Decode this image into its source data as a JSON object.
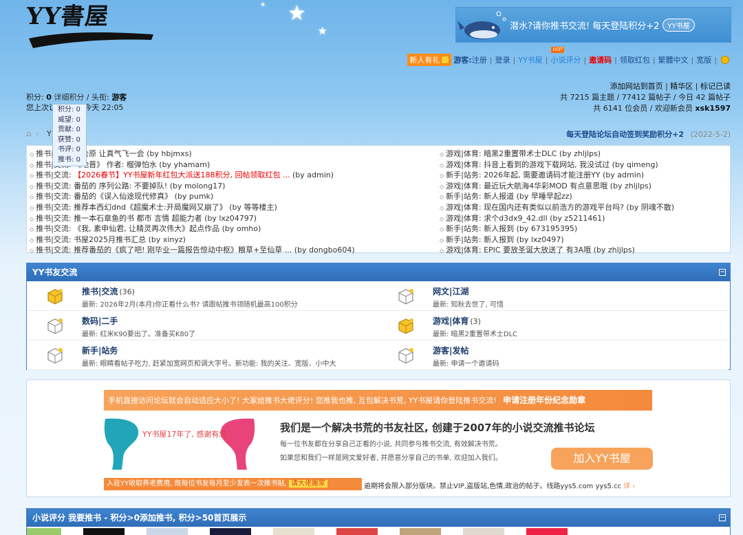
{
  "header": {
    "logo_text": "YY書屋",
    "banner_text": "潜水?请你推书交流! 每天登陆积分+2",
    "banner_badge": "YY书屋"
  },
  "topnav": {
    "newbie": "新人有礼",
    "guest_label": "游客:",
    "register": "注册",
    "login": "登录",
    "yy_shuwu": "YY书屋",
    "hot_badge": "HOT",
    "novel_rating": "小说评分",
    "invite_code": "邀请码",
    "red_packet": "领取红包",
    "trad_simp": "繁體中文",
    "wide": "宽版"
  },
  "userinfo": {
    "points_label": "积分:",
    "points_value": "0",
    "detail_points": "详细积分",
    "title_label": "头衔:",
    "title_value": "游客",
    "last_visit": "您上次访问是在: 今天 22:05",
    "dropdown": [
      "积分: 0",
      "威望: 0",
      "贡献: 0",
      "获赞: 0",
      "书评: 0",
      "推书: 0"
    ]
  },
  "siteinfo": {
    "add_home": "添加网站到首页",
    "featured": "精华区",
    "mark_read": "标记已读",
    "stats_line": "共 7215 篇主题 / 77412 篇帖子 / 今日 42 篇帖子",
    "members_line": "共 6141 位会员 / 欢迎新会员",
    "new_member": "xsk1597"
  },
  "crumb": {
    "text": "Y",
    "checkin": "每天登陆论坛自动签到奖励积分+2",
    "checkin_date": "(2022-5-2)"
  },
  "announcements": {
    "left": [
      {
        "cat": "推书|交流",
        "title": "一会原 让真气飞一会",
        "by": "(by hbjmxs)",
        "red": false
      },
      {
        "cat": "推书|交流",
        "title": "《地晋》 作者: 榴弹怕水",
        "by": "(by yhamam)",
        "red": false
      },
      {
        "cat": "推书|交流",
        "title": "【2026春节】YY书屋新年红包大派送188积分, 回帖领取红包 ...",
        "by": "(by admin)",
        "red": true
      },
      {
        "cat": "推书|交流",
        "title": "番茄的 序列公路: 不要掉队!",
        "by": "(by molong17)",
        "red": false
      },
      {
        "cat": "推书|交流",
        "title": "番茄的《误入仙途现代修真》",
        "by": "(by pumk)",
        "red": false
      },
      {
        "cat": "推书|交流",
        "title": "推荐本西幻dnd《超魔术士:开局魔网又崩了》",
        "by": "(by 等等楼主)",
        "red": false
      },
      {
        "cat": "推书|交流",
        "title": "推一本石章鱼的书 都市 言情 超能力者",
        "by": "(by lxz04797)",
        "red": false
      },
      {
        "cat": "推书|交流",
        "title": "《我, 素申仙君, 让精灵再次伟大》起点作品",
        "by": "(by omho)",
        "red": false
      },
      {
        "cat": "推书|交流",
        "title": "书屋2025月推书汇总",
        "by": "(by xinyz)",
        "red": false
      },
      {
        "cat": "推书|交流",
        "title": "推荐番茄的《疯了吧! 刚毕业一篇报告惊动中枢》粮草+至仙草 ...",
        "by": "(by dongbo604)",
        "red": false
      }
    ],
    "right": [
      {
        "cat": "游戏|体育",
        "title": "暗黑2重置带术士DLC",
        "by": "(by zhljlps)",
        "red": false
      },
      {
        "cat": "游戏|体育",
        "title": "抖音上看到的游戏下载网站, 我没试过",
        "by": "(by qimeng)",
        "red": false
      },
      {
        "cat": "新手|站务",
        "title": "2026年起, 需要邀请码才能注册YY",
        "by": "(by admin)",
        "red": false
      },
      {
        "cat": "游戏|体育",
        "title": "最近玩大航海4华彩MOD 有点意思哦",
        "by": "(by zhljlps)",
        "red": false
      },
      {
        "cat": "新手|站务",
        "title": "新人报道",
        "by": "(by 早睡早起zz)",
        "red": false
      },
      {
        "cat": "游戏|体育",
        "title": "现在国内还有类似以前浩方的游戏平台吗? ",
        "by": "(by 阴魂不散)",
        "red": false
      },
      {
        "cat": "游戏|体育",
        "title": "求个d3dx9_42.dll",
        "by": "(by z5211461)",
        "red": false
      },
      {
        "cat": "新手|站务",
        "title": "新人报到",
        "by": "(by 673195395)",
        "red": false
      },
      {
        "cat": "新手|站务",
        "title": "新人报到",
        "by": "(by lxz0497)",
        "red": false
      },
      {
        "cat": "游戏|体育",
        "title": "EPIC 要放圣诞大放送了 有3A哦",
        "by": "(by zhljlps)",
        "red": false
      }
    ]
  },
  "forum_panel": {
    "title": "YY书友交流",
    "collapse": "−",
    "forums": [
      {
        "name": "推书|交流",
        "count": "(36)",
        "latest": "最新: 2026年2月(本月)你正看什么书? 请跟帖推书领随机最高100积分",
        "active": true
      },
      {
        "name": "网文|江湖",
        "count": "",
        "latest": "最新: 知秋去世了, 可惜",
        "active": false
      },
      {
        "name": "数码|二手",
        "count": "",
        "latest": "最新: 红米K90要出了。准备买K80了",
        "active": false
      },
      {
        "name": "游戏|体育",
        "count": "(3)",
        "latest": "最新: 暗黑2重置带术士DLC",
        "active": true
      },
      {
        "name": "新手|站务",
        "count": "",
        "latest": "最新: 眼睛看帖子吃力, 赶紧加宽网页和调大字号。新功能: 我的关注、宽版、小中大",
        "active": false
      },
      {
        "name": "游客|发帖",
        "count": "",
        "latest": "最新: 申请一个邀请码",
        "active": false
      }
    ]
  },
  "promo": {
    "bar_text": "手机直接访问论坛就会自动适应大小了! 大家给推书大佬评分! 您推我也推, 互包解决书荒, YY书屋请你登陆推书交流!",
    "bar_bold": "申请注册年份纪念勋章",
    "age_text": "YY书屋17年了, 感谢有您",
    "slogan": "我们是一个解决书荒的书友社区, 创建于2007年的小说交流推书论坛",
    "sub1": "每一位书友都在分享自己正看的小说, 共同参与推书交流, 有效解决书荒。",
    "sub2": "如果您和我们一样是网文爱好者, 并愿意分享自己的书单, 欢迎加入我们。",
    "join": "加入YY书屋",
    "bottom_bar": "入驻YY收取养老费用, 既每位书友每月至少发表一次推书贴,",
    "bottom_highlight": "请大佬搬家",
    "bottom_text": "逾期将会限入部分版块。禁止VIP,盗版站,色情,政治的帖子。线路yys5.com yys5.cc",
    "bottom_more": "详 ›"
  },
  "rating_panel": {
    "title": "小说评分 我要推书 - 积分>0添加推书, 积分>50首页展示",
    "collapse": "−"
  },
  "colors": {
    "panel_blue": "#3e7fc5",
    "link_blue": "#1c4c8c",
    "accent_orange": "#f48a3b",
    "alert_red": "#e00000"
  }
}
